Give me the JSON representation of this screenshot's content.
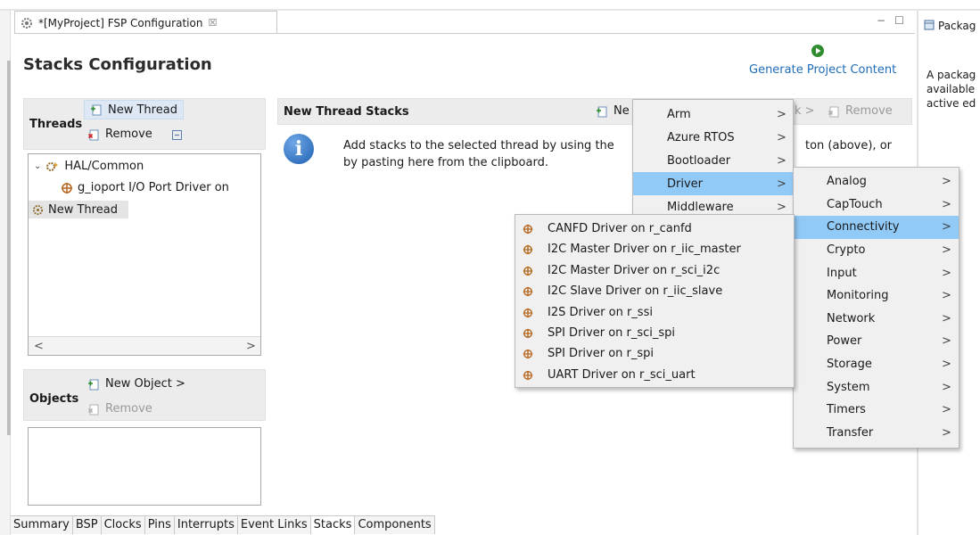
{
  "editor": {
    "tab_title": "*[MyProject] FSP Configuration",
    "tab_close": "☒",
    "page_title": "Stacks Configuration",
    "generate_label": "Generate Project Content",
    "minimize": "−",
    "maximize": "☐"
  },
  "threads": {
    "label": "Threads",
    "new_thread": "New Thread",
    "remove": "Remove",
    "tree": {
      "hal_common": "HAL/Common",
      "ioport": "g_ioport I/O Port Driver on",
      "new_thread": "New Thread"
    },
    "scroll_left": "<",
    "scroll_right": ">"
  },
  "objects": {
    "label": "Objects",
    "new_object": "New Object >",
    "remove": "Remove"
  },
  "stacks": {
    "title": "New Thread Stacks",
    "new_label": "Ne",
    "remove": "Remove",
    "partial_arrow": "k >",
    "info_icon_letter": "i",
    "info_line1_start": "Add stacks to the selected thread by using the",
    "info_line1_end": "ton (above), or",
    "info_line2": "by pasting here from the clipboard."
  },
  "bottom_tabs": [
    "Summary",
    "BSP",
    "Clocks",
    "Pins",
    "Interrupts",
    "Event Links",
    "Stacks",
    "Components"
  ],
  "bottom_active": "Stacks",
  "right_panel": {
    "tab": "Packag",
    "lines": [
      "A packag",
      "available",
      "active ed"
    ]
  },
  "menu_top": {
    "items": [
      "Arm",
      "Azure RTOS",
      "Bootloader",
      "Driver",
      "Middleware"
    ],
    "selected": "Driver"
  },
  "menu_driver": {
    "items": [
      "Analog",
      "CapTouch",
      "Connectivity",
      "Crypto",
      "Input",
      "Monitoring",
      "Network",
      "Power",
      "Storage",
      "System",
      "Timers",
      "Transfer"
    ],
    "selected": "Connectivity"
  },
  "menu_connectivity": {
    "items": [
      "CANFD Driver on r_canfd",
      "I2C Master Driver on r_iic_master",
      "I2C Master Driver on r_sci_i2c",
      "I2C Slave Driver on r_iic_slave",
      "I2S Driver on r_ssi",
      "SPI Driver on r_sci_spi",
      "SPI Driver on r_spi",
      "UART Driver on r_sci_uart"
    ]
  },
  "submenu_arrow": ">",
  "colors": {
    "selection": "#91c9f7",
    "link": "#1f6db8",
    "generate": "#2f8d2f",
    "driver_icon": "#b5651d"
  }
}
